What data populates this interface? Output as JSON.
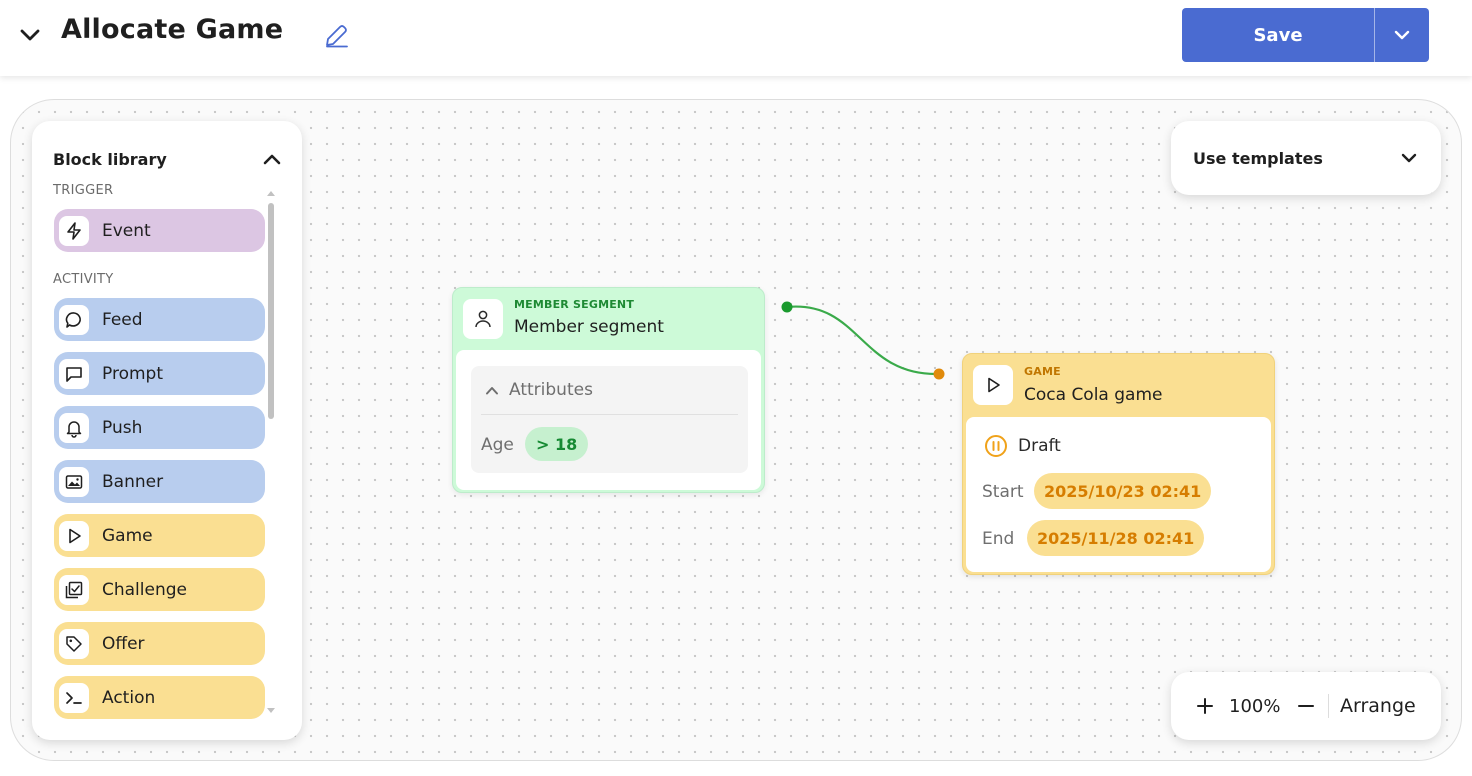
{
  "header": {
    "title": "Allocate Game",
    "save_label": "Save"
  },
  "library": {
    "title": "Block library",
    "sections": [
      {
        "label": "TRIGGER",
        "items": [
          {
            "label": "Event",
            "icon": "lightning-icon"
          }
        ]
      },
      {
        "label": "ACTIVITY",
        "items": [
          {
            "label": "Feed",
            "icon": "speech-bubble-icon"
          },
          {
            "label": "Prompt",
            "icon": "message-square-icon"
          },
          {
            "label": "Push",
            "icon": "bell-icon"
          },
          {
            "label": "Banner",
            "icon": "image-icon"
          },
          {
            "label": "Game",
            "icon": "play-icon"
          },
          {
            "label": "Challenge",
            "icon": "checklist-icon"
          },
          {
            "label": "Offer",
            "icon": "tag-icon"
          },
          {
            "label": "Action",
            "icon": "terminal-icon"
          }
        ]
      }
    ]
  },
  "templates": {
    "label": "Use templates"
  },
  "zoom": {
    "in_icon": "plus-icon",
    "level": "100%",
    "out_icon": "minus-icon",
    "arrange_label": "Arrange"
  },
  "nodes": {
    "member": {
      "type_label": "MEMBER SEGMENT",
      "name": "Member segment",
      "attributes_label": "Attributes",
      "attribute_name": "Age",
      "attribute_value": "> 18"
    },
    "game": {
      "type_label": "GAME",
      "name": "Coca Cola game",
      "status": "Draft",
      "start_label": "Start",
      "start_value": "2025/10/23 02:41",
      "end_label": "End",
      "end_value": "2025/11/28 02:41"
    }
  },
  "colors": {
    "primary": "#4a6bd1",
    "trigger": "#dcc6e3",
    "activity_blue": "#b8cdee",
    "activity_yellow": "#fadf92",
    "member_node": "#cdfad8",
    "connector": "#3aaa4a",
    "draft_status": "#f0a21a"
  }
}
